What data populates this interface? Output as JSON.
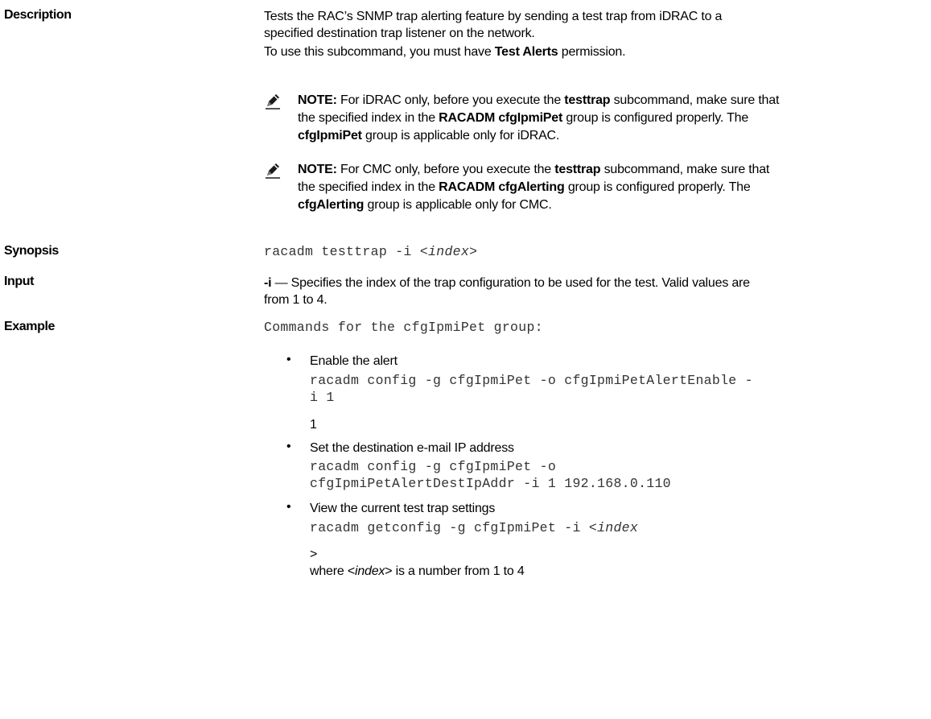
{
  "description": {
    "label": "Description",
    "line1": "Tests the RAC’s SNMP trap alerting feature by sending a test trap from iDRAC to a",
    "line2": "specified destination trap listener on the network.",
    "perm_pre": "To use this subcommand, you must have ",
    "perm_bold": "Test Alerts",
    "perm_post": " permission."
  },
  "notes": [
    {
      "icon": "pencil-note-icon",
      "prefix": "NOTE:",
      "l1_a": " For iDRAC only, before you execute the ",
      "l1_b": "testtrap",
      "l1_c": " subcommand, make sure that",
      "l2_a": "the specified index in the ",
      "l2_b": "RACADM cfgIpmiPet",
      "l2_c": " group is configured properly. The",
      "l3_b": "cfgIpmiPet",
      "l3_c": " group is applicable only for iDRAC."
    },
    {
      "icon": "pencil-note-icon",
      "prefix": "NOTE:",
      "l1_a": " For CMC only, before you execute the ",
      "l1_b": "testtrap",
      "l1_c": " subcommand, make sure that",
      "l2_a": "the specified index in the ",
      "l2_b": "RACADM cfgAlerting",
      "l2_c": " group is configured properly. The",
      "l3_b": "cfgAlerting",
      "l3_c": " group is applicable only for CMC."
    }
  ],
  "synopsis": {
    "label": "Synopsis",
    "cmd": "racadm testtrap -i <",
    "arg": "index",
    "end": ">"
  },
  "input": {
    "label": "Input",
    "flag": "-i",
    "line1": " — Specifies the index of the trap configuration to be used for the test. Valid values are",
    "line2": "from 1 to 4."
  },
  "example": {
    "label": "Example",
    "intro": "Commands for the cfgIpmiPet group:",
    "items": [
      {
        "bullet": "•",
        "text": "Enable the alert",
        "code1": "racadm config -g cfgIpmiPet -o cfgIpmiPetAlertEnable -",
        "code2": "i 1",
        "after": "1"
      },
      {
        "bullet": "•",
        "text": "Set the destination e-mail IP address",
        "code1": "racadm config -g cfgIpmiPet -o",
        "code2": "cfgIpmiPetAlertDestIpAddr -i 1 192.168.0.110"
      },
      {
        "bullet": "•",
        "text": "View the current test trap settings",
        "code1": "racadm getconfig -g cfgIpmiPet -i <",
        "code1_arg": "index",
        "after": ">",
        "where_pre": "where <",
        "where_arg": "index",
        "where_post": "> is a number from 1 to 4"
      }
    ]
  }
}
